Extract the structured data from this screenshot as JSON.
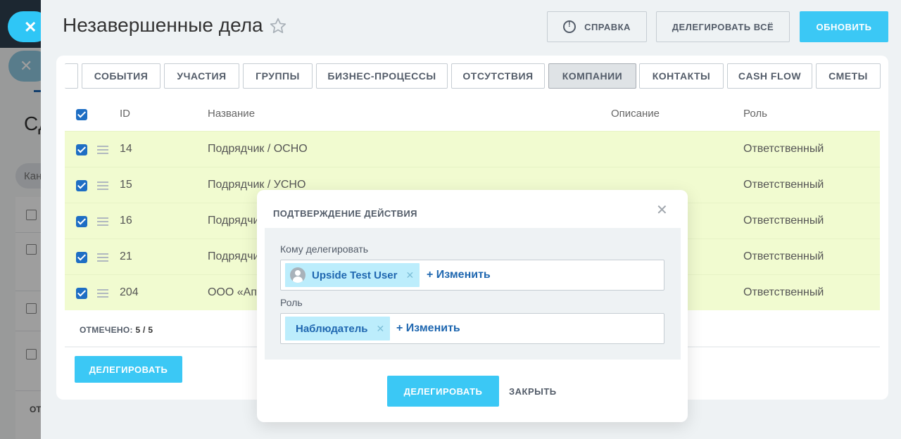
{
  "background": {
    "title_fragment": "Сд",
    "filter_fragment": "Кан",
    "footer_fragment": "ОТ"
  },
  "header": {
    "title": "Незавершенные дела",
    "help_label": "СПРАВКА",
    "delegate_all_label": "ДЕЛЕГИРОВАТЬ ВСЁ",
    "refresh_label": "ОБНОВИТЬ"
  },
  "tabs": [
    {
      "label": "СОБЫТИЯ"
    },
    {
      "label": "УЧАСТИЯ"
    },
    {
      "label": "ГРУППЫ"
    },
    {
      "label": "БИЗНЕС-ПРОЦЕССЫ"
    },
    {
      "label": "ОТСУТСТВИЯ"
    },
    {
      "label": "КОМПАНИИ",
      "active": true
    },
    {
      "label": "КОНТАКТЫ"
    },
    {
      "label": "CASH FLOW"
    },
    {
      "label": "СМЕТЫ"
    }
  ],
  "table": {
    "columns": [
      "ID",
      "Название",
      "Описание",
      "Роль"
    ],
    "rows": [
      {
        "id": "14",
        "name": "Подрядчик / ОСНО",
        "role": "Ответственный"
      },
      {
        "id": "15",
        "name": "Подрядчик / УСНО",
        "role": "Ответственный"
      },
      {
        "id": "16",
        "name": "Подрядчи",
        "role": "Ответственный"
      },
      {
        "id": "21",
        "name": "Подрядчи",
        "role": "Ответственный"
      },
      {
        "id": "204",
        "name": "ООО «Ап",
        "role": "Ответственный"
      }
    ],
    "marked_label": "ОТМЕЧЕНО:",
    "marked_value": "5 / 5",
    "delegate_label": "ДЕЛЕГИРОВАТЬ"
  },
  "modal": {
    "title": "ПОДТВЕРЖДЕНИЕ ДЕЙСТВИЯ",
    "delegate_to_label": "Кому делегировать",
    "user_chip": "Upside Test User",
    "change_label": "+ Изменить",
    "role_label": "Роль",
    "role_chip": "Наблюдатель",
    "confirm_label": "ДЕЛЕГИРОВАТЬ",
    "close_label": "ЗАКРЫТЬ"
  },
  "colors": {
    "accent": "#3bc8f5",
    "row_highlight": "#f1fbd0",
    "link": "#1f67b0"
  }
}
